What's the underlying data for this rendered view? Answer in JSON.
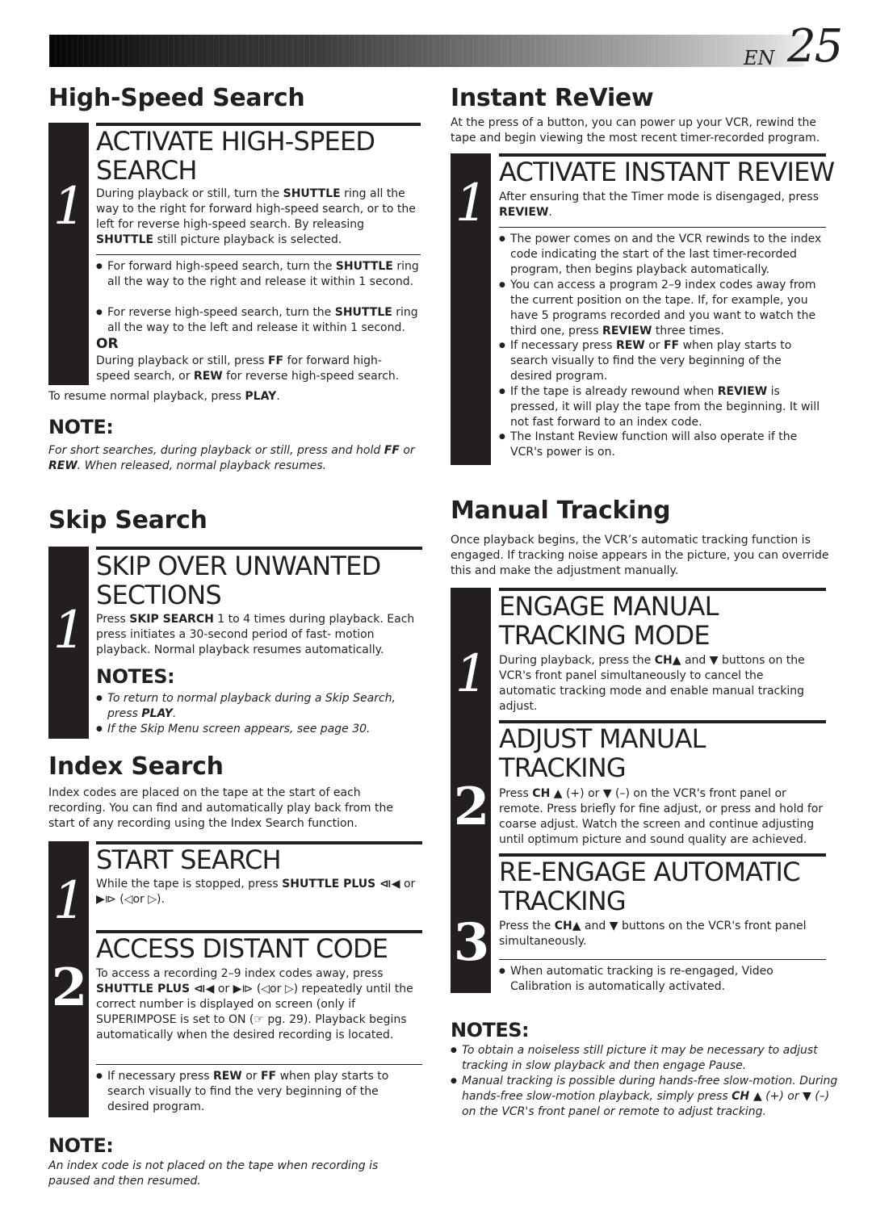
{
  "header": {
    "lang": "EN",
    "page_number": "25"
  },
  "high_speed": {
    "title": "High-Speed Search",
    "step1": {
      "number": "1",
      "title_line1": "ACTIVATE HIGH-SPEED",
      "title_line2": "SEARCH",
      "body": [
        "During playback or still, turn the ",
        "SHUTTLE",
        " ring all the way to the right for forward high-speed search, or to the left for reverse high-speed search. By releasing ",
        "SHUTTLE",
        " still picture playback is selected."
      ],
      "bullets": [
        [
          "For forward high-speed search, turn the ",
          "SHUTTLE",
          " ring all the way to the right and release it within 1 second."
        ],
        [
          "For reverse high-speed search, turn the ",
          "SHUTTLE",
          " ring all the way to the left and release it within 1 second."
        ]
      ],
      "or_label": "OR",
      "or_body": [
        "During playback or still, press ",
        "FF",
        " for forward high-speed search, or ",
        "REW",
        " for reverse high-speed search."
      ]
    },
    "resume": [
      "To resume normal playback, press ",
      "PLAY",
      "."
    ],
    "note_heading": "NOTE:",
    "note": [
      "For short searches, during playback or still, press and hold ",
      "FF",
      " or ",
      "REW",
      ". When released, normal playback resumes."
    ]
  },
  "skip": {
    "title": "Skip Search",
    "step1": {
      "number": "1",
      "title_line1": "SKIP OVER UNWANTED",
      "title_line2": "SECTIONS",
      "body": [
        "Press ",
        "SKIP SEARCH",
        " 1 to 4 times during playback. Each press initiates a 30-second period of fast- motion playback. Normal playback resumes automatically."
      ],
      "notes_heading": "NOTES:",
      "notes": [
        [
          "To return to normal playback during a Skip Search, press ",
          "PLAY",
          "."
        ],
        [
          "If the Skip Menu screen appears, see page 30.",
          "",
          ""
        ]
      ]
    }
  },
  "index": {
    "title": "Index Search",
    "intro": "Index codes are placed on the tape at the start of each recording. You can find and automatically play back from the start of any recording using the Index Search function.",
    "step1": {
      "number": "1",
      "title": "START SEARCH",
      "body": [
        "While the tape is stopped, press ",
        "SHUTTLE PLUS ⧏◀",
        " or ▶⧐ (◁or ▷)."
      ]
    },
    "step2": {
      "number": "2",
      "title": "ACCESS DISTANT CODE",
      "body": [
        "To access a recording 2–9 index codes away, press ",
        "SHUTTLE PLUS ⧏◀",
        " or ▶⧐ (◁or ▷) repeatedly until the correct number is displayed on screen (only if SUPERIMPOSE is set to ON (☞ pg. 29). Playback begins automatically when the desired recording is located."
      ],
      "bullets": [
        [
          "If necessary press ",
          "REW",
          " or ",
          "FF",
          " when play starts to search visually to find the very beginning of the desired program."
        ]
      ]
    },
    "note_heading": "NOTE:",
    "note": "An index code is not placed on the tape when recording is paused and then resumed."
  },
  "instant": {
    "title": "Instant ReView",
    "intro": "At the press of a button, you can power up your VCR, rewind the tape and begin viewing the most recent timer-recorded program.",
    "step1": {
      "number": "1",
      "title": "ACTIVATE INSTANT REVIEW",
      "body": [
        "After ensuring that the Timer mode is disengaged, press ",
        "REVIEW",
        "."
      ],
      "bullets": [
        [
          "The power comes on and the VCR rewinds to the index code indicating the start of the last timer-recorded program, then begins playback automatically.",
          "",
          ""
        ],
        [
          "You can access a program 2–9 index codes away from the current position on the tape. If, for example, you have 5 programs recorded and you want to watch the third one, press ",
          "REVIEW",
          " three times."
        ],
        [
          "If necessary press ",
          "REW",
          " or ",
          "FF",
          " when play starts to search visually to find the very beginning of the desired program."
        ],
        [
          "If the tape is already rewound when ",
          "REVIEW",
          " is pressed, it will play the tape from the beginning. It will not fast forward to an index code."
        ],
        [
          "The Instant Review function will also operate if the VCR's power is on.",
          "",
          ""
        ]
      ]
    }
  },
  "manual": {
    "title": "Manual Tracking",
    "intro": "Once playback begins, the VCR’s automatic tracking function is engaged. If tracking noise appears in the picture, you can override this and make the adjustment manually.",
    "step1": {
      "number": "1",
      "title_line1": "ENGAGE MANUAL",
      "title_line2": "TRACKING MODE",
      "body": [
        "During playback, press the ",
        "CH▲",
        " and ▼ buttons on the VCR's front panel simultaneously to cancel the automatic tracking mode and enable manual tracking adjust."
      ]
    },
    "step2": {
      "number": "2",
      "title_line1": "ADJUST MANUAL",
      "title_line2": "TRACKING",
      "body": [
        "Press ",
        "CH",
        " ▲ (+) or ▼ (–) on the VCR's front panel or remote. Press briefly for fine adjust, or press and hold for coarse adjust. Watch the screen and continue adjusting until optimum picture and sound quality are achieved."
      ]
    },
    "step3": {
      "number": "3",
      "title_line1": "RE-ENGAGE AUTOMATIC",
      "title_line2": "TRACKING",
      "body": [
        "Press the ",
        "CH▲",
        " and ▼ buttons on the VCR's front panel simultaneously."
      ],
      "bullets": [
        "When automatic tracking is re-engaged, Video Calibration is automatically activated."
      ]
    },
    "notes_heading": "NOTES:",
    "notes": [
      [
        "To obtain a noiseless still picture it may be necessary to adjust tracking in slow playback and then engage Pause.",
        "",
        ""
      ],
      [
        "Manual tracking is possible during hands-free slow-motion. During hands-free slow-motion playback, simply press ",
        "CH ▲",
        " (+) or ▼ (–) on the VCR's front panel or remote to adjust tracking."
      ]
    ]
  }
}
